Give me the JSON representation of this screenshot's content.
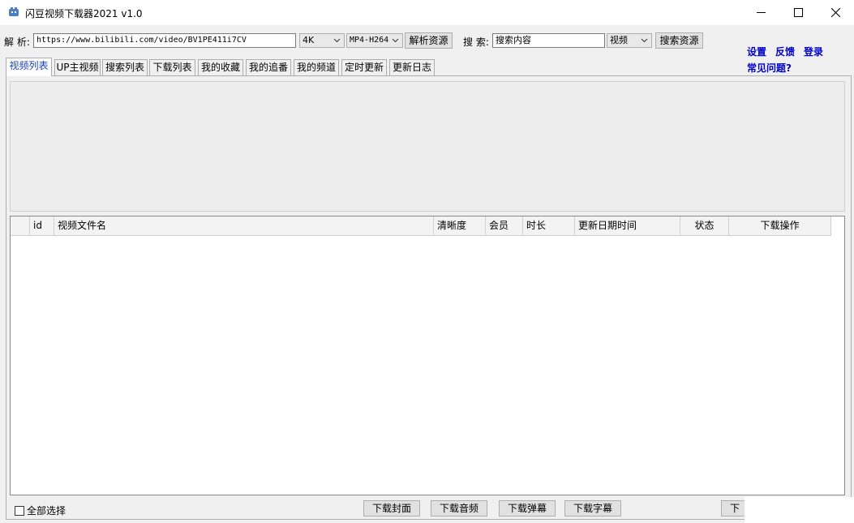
{
  "window": {
    "title": "闪豆视频下载器2021 v1.0",
    "minimize_glyph": "—",
    "maximize_glyph": "☐",
    "close_glyph": "✕"
  },
  "toolbar": {
    "parse_label": "解 析:",
    "url_value": "https://www.bilibili.com/video/BV1PE411i7CV",
    "quality_selected": "4K",
    "format_selected": "MP4-H264",
    "parse_button": "解析资源",
    "search_label": "搜 索:",
    "search_value": "搜索内容",
    "search_type_selected": "视频",
    "search_button": "搜索资源"
  },
  "links": {
    "settings": "设置",
    "feedback": "反馈",
    "login": "登录",
    "faq": "常见问题?"
  },
  "tabs": [
    {
      "label": "视频列表"
    },
    {
      "label": "UP主视频"
    },
    {
      "label": "搜索列表"
    },
    {
      "label": "下载列表"
    },
    {
      "label": "我的收藏"
    },
    {
      "label": "我的追番"
    },
    {
      "label": "我的频道"
    },
    {
      "label": "定时更新"
    },
    {
      "label": "更新日志"
    }
  ],
  "table": {
    "columns": [
      "",
      "id",
      "视频文件名",
      "清晰度",
      "会员",
      "时长",
      "更新日期时间",
      "状态",
      "下载操作"
    ]
  },
  "footer": {
    "select_all": "全部选择",
    "download_cover": "下载封面",
    "download_audio": "下载音频",
    "download_danmaku": "下载弹幕",
    "download_subtitle": "下载字幕",
    "download_partial": "下载"
  },
  "colors": {
    "link": "#0000cc",
    "active_tab_text": "#1a3fb8",
    "app_icon": "#4a7fc1"
  }
}
